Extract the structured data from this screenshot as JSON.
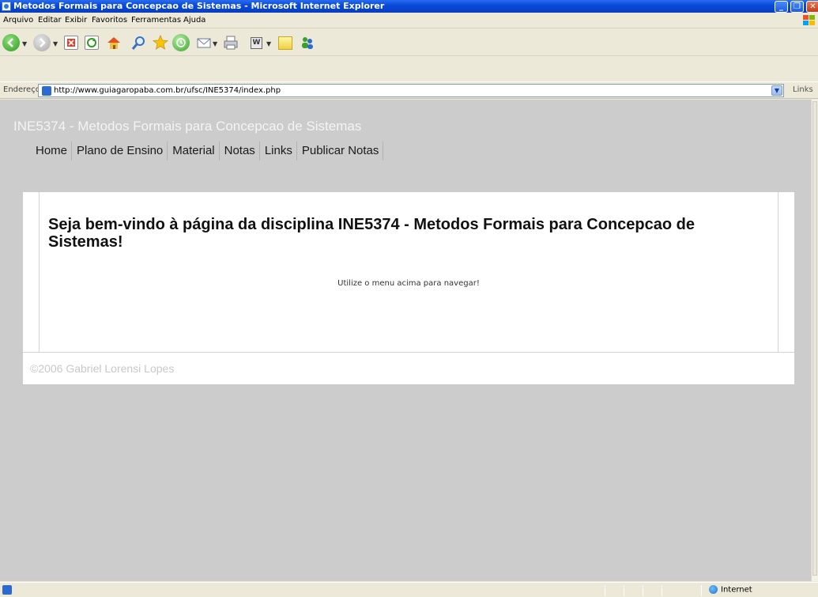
{
  "window": {
    "title": "Metodos Formais para Concepcao de Sistemas - Microsoft Internet Explorer",
    "minimize": "_",
    "maximize": "❐",
    "close": "✕"
  },
  "menu": {
    "items": [
      "Arquivo",
      "Editar",
      "Exibir",
      "Favoritos",
      "Ferramentas",
      "Ajuda"
    ]
  },
  "address": {
    "label": "Endereço",
    "url": "http://www.guiagaropaba.com.br/ufsc/INE5374/index.php",
    "links_label": "Links"
  },
  "page": {
    "site_title": "INE5374 - Metodos Formais para Concepcao de Sistemas",
    "nav": [
      "Home",
      "Plano de Ensino",
      "Material",
      "Notas",
      "Links",
      "Publicar Notas"
    ],
    "welcome": "Seja bem-vindo à página da disciplina INE5374 - Metodos Formais para Concepcao de Sistemas!",
    "hint": "Utilize o menu acima para navegar!",
    "footer": "©2006 Gabriel Lorensi Lopes"
  },
  "status": {
    "zone": "Internet"
  },
  "colors": {
    "titlebar": "#0a4bd8",
    "page_bg": "#cccccc",
    "content_bg": "#ffffff",
    "site_title": "#f4f4f4"
  }
}
